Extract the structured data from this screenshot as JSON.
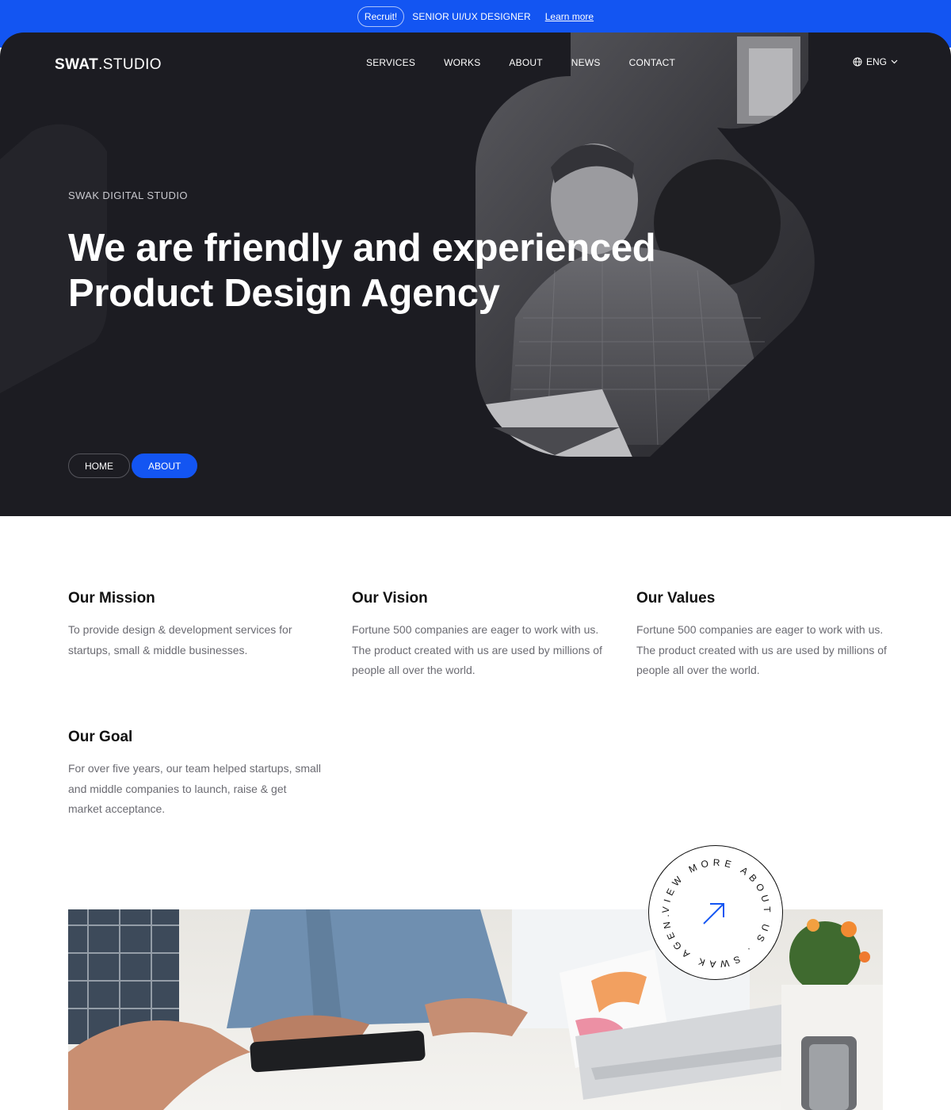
{
  "topbar": {
    "badge": "Recruit!",
    "role": "SENIOR UI/UX DESIGNER",
    "link": "Learn more"
  },
  "header": {
    "logo_bold": "SWAT",
    "logo_light": ".STUDIO",
    "nav": [
      "SERVICES",
      "WORKS",
      "ABOUT",
      "NEWS",
      "CONTACT"
    ],
    "language": "ENG"
  },
  "hero": {
    "eyebrow": "SWAK DIGITAL STUDIO",
    "headline_line1": "We are friendly and experienced",
    "headline_line2": "Product Design Agency",
    "breadcrumb": [
      "HOME",
      "ABOUT"
    ]
  },
  "sections": [
    {
      "title": "Our Mission",
      "text": "To provide design & development services for startups, small & middle businesses."
    },
    {
      "title": "Our Vision",
      "text": "Fortune 500 companies are eager to work with us. The product created with us are used by millions of people all over the world."
    },
    {
      "title": "Our Values",
      "text": "Fortune 500 companies are eager to work with us. The product created with us are used by millions of people all over the world."
    },
    {
      "title": "Our Goal",
      "text": "For over five years, our team helped startups, small and middle companies to launch, raise & get market acceptance."
    }
  ],
  "badge": {
    "circle_text": "VIEW MORE ABOUT US . SWAK AGEN. "
  },
  "colors": {
    "accent": "#1355f2",
    "hero_bg": "#1c1c22",
    "body_text": "#6b6b72"
  }
}
